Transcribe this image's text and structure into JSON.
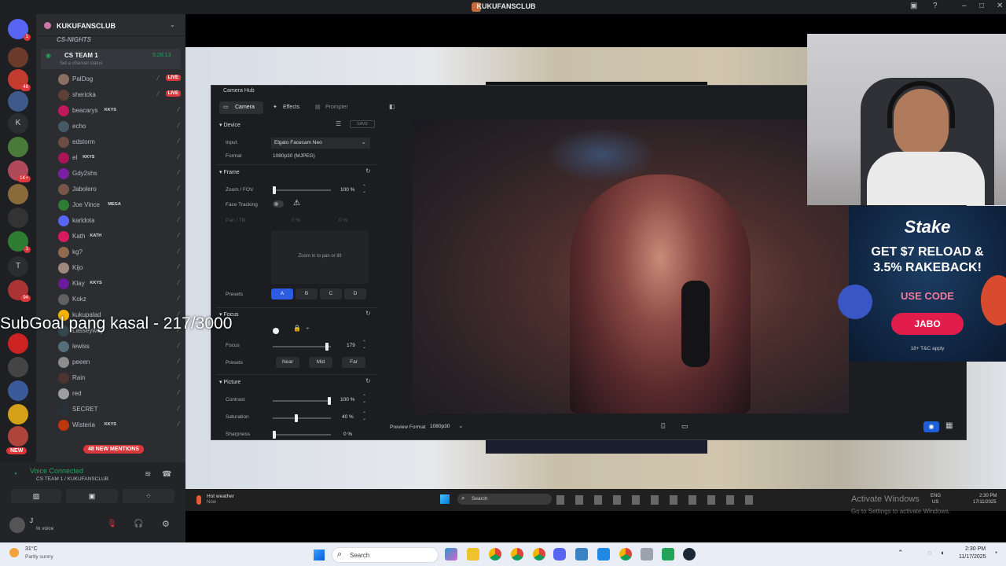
{
  "window": {
    "title": "KUKUFANSCLUB"
  },
  "server": {
    "name": "KUKUFANSCLUB",
    "category": "CS-NIGHTS"
  },
  "channel": {
    "name": "CS TEAM 1",
    "timer": "5:28:13",
    "status_prompt": "Set a channel status"
  },
  "members": [
    {
      "name": "PalDog",
      "badge": "",
      "live": true
    },
    {
      "name": "shericka",
      "badge": "",
      "live": true
    },
    {
      "name": "beacarys",
      "badge": "KKYS",
      "live": false
    },
    {
      "name": "echo",
      "badge": "",
      "live": false
    },
    {
      "name": "edstorm",
      "badge": "",
      "live": false
    },
    {
      "name": "el",
      "badge": "KKYS",
      "live": false
    },
    {
      "name": "Gdy2shs",
      "badge": "",
      "live": false
    },
    {
      "name": "Jabolero",
      "badge": "",
      "live": false
    },
    {
      "name": "Joe Vince",
      "badge": "MEGA",
      "live": false
    },
    {
      "name": "karldota",
      "badge": "",
      "live": false
    },
    {
      "name": "Kath",
      "badge": "KATH",
      "live": false
    },
    {
      "name": "kg?",
      "badge": "",
      "live": false
    },
    {
      "name": "Kijo",
      "badge": "",
      "live": false
    },
    {
      "name": "Klay",
      "badge": "KKYS",
      "live": false
    },
    {
      "name": "Kokz",
      "badge": "",
      "live": false
    },
    {
      "name": "kukupalad",
      "badge": "",
      "live": false
    },
    {
      "name": "Lasseyway",
      "badge": "",
      "live": false
    },
    {
      "name": "lewiss",
      "badge": "",
      "live": false
    },
    {
      "name": "peeen",
      "badge": "",
      "live": false
    },
    {
      "name": "Rain",
      "badge": "",
      "live": false
    },
    {
      "name": "red",
      "badge": "",
      "live": false
    },
    {
      "name": "SECRET",
      "badge": "",
      "live": false
    },
    {
      "name": "Wisteria",
      "badge": "KKYS",
      "live": false
    }
  ],
  "live_label": "LIVE",
  "new_mentions": "48 NEW MENTIONS",
  "new_label": "NEW",
  "overlay_text": "SubGoal pang kasal - 217/3000",
  "voice": {
    "status": "Voice Connected",
    "location": "CS TEAM 1 / KUKUFANSCLUB"
  },
  "user": {
    "name": "J",
    "status": "In voice"
  },
  "camera_hub": {
    "title": "Camera Hub",
    "tabs": [
      "Camera",
      "Effects",
      "Prompter"
    ],
    "device": {
      "header": "Device",
      "save": "SAVE",
      "input_label": "Input",
      "input_value": "Elgato Facecam Neo",
      "format_label": "Format",
      "format_value": "1080p30 (MJPEG)"
    },
    "frame": {
      "header": "Frame",
      "zoom_label": "Zoom / FOV",
      "zoom_value": "100 %",
      "zoom_level": 0,
      "face_label": "Face Tracking",
      "pan_label": "Pan / Tilt",
      "pan_value": "0 %",
      "tilt_value": "0 %",
      "hint": "Zoom in to pan or tilt",
      "presets_label": "Presets",
      "presets": [
        "A",
        "B",
        "C",
        "D"
      ]
    },
    "focus": {
      "header": "Focus",
      "focus_label": "Focus",
      "focus_value": "179",
      "focus_level": 0.96,
      "presets_label": "Presets",
      "presets": [
        "Near",
        "Mid",
        "Far"
      ]
    },
    "picture": {
      "header": "Picture",
      "contrast_label": "Contrast",
      "contrast_value": "100 %",
      "contrast_level": 1.0,
      "saturation_label": "Saturation",
      "saturation_value": "40 %",
      "saturation_level": 0.4,
      "sharpness_label": "Sharpness",
      "sharpness_value": "0 %"
    },
    "preview_label": "Preview Format",
    "preview_value": "1080p30"
  },
  "ad": {
    "brand": "Stake",
    "line1": "GET $7 RELOAD &",
    "line2": "3.5% RAKEBACK!",
    "use_code": "USE CODE",
    "code": "JABO",
    "fine": "18+ T&C apply"
  },
  "stream_taskbar": {
    "weather": "Hot weather",
    "weather_sub": "Now",
    "search": "Search",
    "lang": "ENG",
    "region": "US",
    "time": "2:30 PM",
    "date": "17/11/2025"
  },
  "activate": {
    "title": "Activate Windows",
    "sub": "Go to Settings to activate Windows."
  },
  "taskbar": {
    "temp": "31°C",
    "weather": "Partly sunny",
    "search": "Search",
    "time": "2:30 PM",
    "date": "11/17/2025"
  }
}
